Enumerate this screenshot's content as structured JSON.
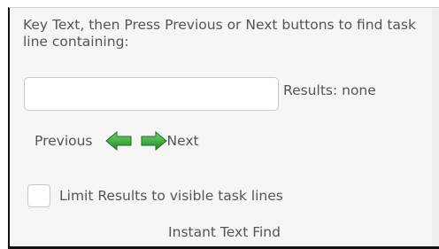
{
  "panel": {
    "instructions": "Key Text, then Press Previous or Next buttons to find task line containing:",
    "search": {
      "value": "",
      "placeholder": ""
    },
    "results_label": "Results: none",
    "nav": {
      "previous_label": "Previous",
      "next_label": "Next",
      "previous_icon": "arrow-left-icon",
      "next_icon": "arrow-right-icon",
      "arrow_color": "#3aa53a"
    },
    "limit": {
      "label": "Limit Results to visible task lines",
      "checked": false
    },
    "title": "Instant Text Find"
  }
}
